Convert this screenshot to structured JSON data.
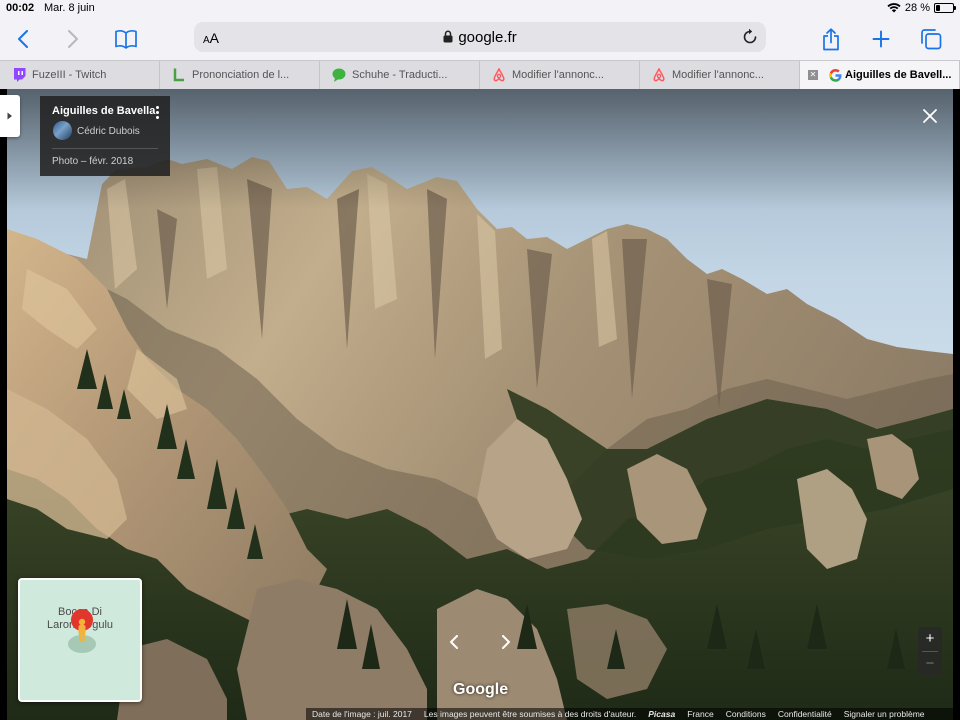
{
  "status_bar": {
    "time": "00:02",
    "date": "Mar. 8 juin",
    "battery_text": "28 %",
    "battery_level": 0.28
  },
  "toolbar": {
    "text_size_label_small": "A",
    "text_size_label_large": "A",
    "url_domain": "google.fr"
  },
  "tabs": [
    {
      "label": "FuzeIII - Twitch",
      "icon": "twitch-icon",
      "color": "#9146ff"
    },
    {
      "label": "Prononciation de l...",
      "icon": "letter-l-icon",
      "color": "#48a23f"
    },
    {
      "label": "Schuhe - Traducti...",
      "icon": "speech-bubble-icon",
      "color": "#3fb23f"
    },
    {
      "label": "Modifier l'annonc...",
      "icon": "airbnb-icon",
      "color": "#ff5a5f"
    },
    {
      "label": "Modifier l'annonc...",
      "icon": "airbnb-icon",
      "color": "#ff5a5f"
    },
    {
      "label": "Aiguilles de Bavell...",
      "icon": "google-g-icon",
      "color": "#4285f4",
      "active": true
    }
  ],
  "info_card": {
    "title": "Aiguilles de Bavella",
    "author": "Cédric Dubois",
    "photo_date": "Photo – févr. 2018"
  },
  "minimap": {
    "place_line1": "Bocca Di",
    "place_line2": "Larone Ugulu"
  },
  "google_logo": "Google",
  "zoom": {
    "in_label": "+",
    "out_label": "−"
  },
  "footer": {
    "image_date": "Date de l'image : juil. 2017",
    "rights": "Les images peuvent être soumises à des droits d'auteur.",
    "provider": "Picasa",
    "country": "France",
    "terms": "Conditions",
    "privacy": "Confidentialité",
    "report": "Signaler un problème"
  },
  "colors": {
    "accent": "#1a73e8",
    "sky_top": "#c3d6e6",
    "sky_bottom": "#e9eef0"
  }
}
